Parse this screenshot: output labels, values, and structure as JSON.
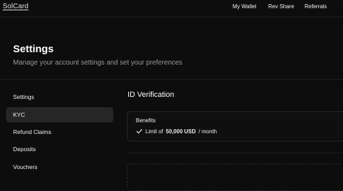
{
  "header": {
    "logo": "SolCard",
    "nav": [
      "My Wallet",
      "Rev Share",
      "Referrals"
    ]
  },
  "page": {
    "title": "Settings",
    "subtitle": "Manage your account settings and set your preferences"
  },
  "sidebar": {
    "items": [
      {
        "label": "Settings",
        "active": false
      },
      {
        "label": "KYC",
        "active": true
      },
      {
        "label": "Refund Claims",
        "active": false
      },
      {
        "label": "Deposits",
        "active": false
      },
      {
        "label": "Vouchers",
        "active": false
      }
    ]
  },
  "main": {
    "section_title": "ID Verification",
    "benefits": {
      "title": "Benefits",
      "limit_prefix": "Limit of",
      "limit_amount": "50,000 USD",
      "limit_suffix": "/ month"
    }
  },
  "colors": {
    "background": "#0d0d0d",
    "active_item": "#262626",
    "text_muted": "#9a9a9a"
  }
}
